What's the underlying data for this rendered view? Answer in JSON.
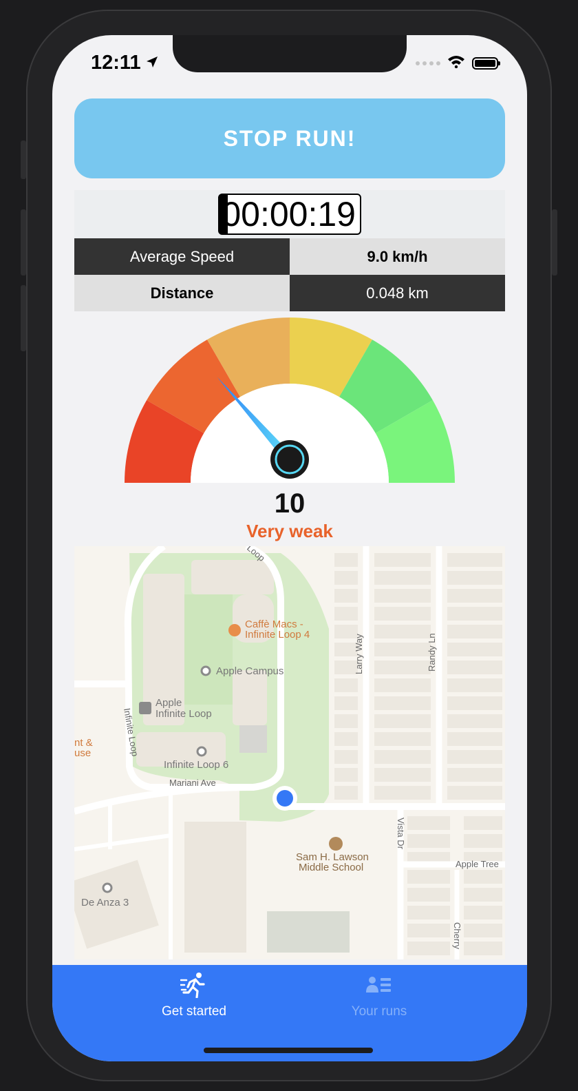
{
  "status_bar": {
    "time": "12:11"
  },
  "run": {
    "stop_label": "STOP RUN!",
    "timer": "00:00:19",
    "stats": {
      "avg_speed_label": "Average Speed",
      "avg_speed_value": "9.0 km/h",
      "distance_label": "Distance",
      "distance_value": "0.048 km"
    }
  },
  "gauge": {
    "score": "10",
    "rating": "Very weak",
    "rating_color": "#e8622a",
    "needle_fraction": 0.27,
    "segment_colors": [
      "#e94427",
      "#ec6630",
      "#e9b05a",
      "#ebd04f",
      "#6be57a",
      "#7af47c"
    ]
  },
  "map": {
    "labels": {
      "cafe": "Caffè Macs -",
      "cafe2": "Infinite Loop 4",
      "campus": "Apple Campus",
      "apple1": "Apple",
      "apple2": "Infinite Loop",
      "loop6": "Infinite Loop 6",
      "loop_road": "Infinite Loop",
      "loop_top": "Loop",
      "mariani": "Mariani Ave",
      "larry": "Larry Way",
      "randy": "Randy Ln",
      "vista": "Vista Dr",
      "appletree": "Apple Tree",
      "cherry": "Cherry",
      "school1": "Sam H. Lawson",
      "school2": "Middle School",
      "deanza": "De Anza 3",
      "left1": "nt &",
      "left2": "use"
    },
    "accent_color": "#3478f6"
  },
  "tabs": [
    {
      "label": "Get started",
      "icon": "running-person-icon",
      "active": true
    },
    {
      "label": "Your runs",
      "icon": "people-list-icon",
      "active": false
    }
  ]
}
